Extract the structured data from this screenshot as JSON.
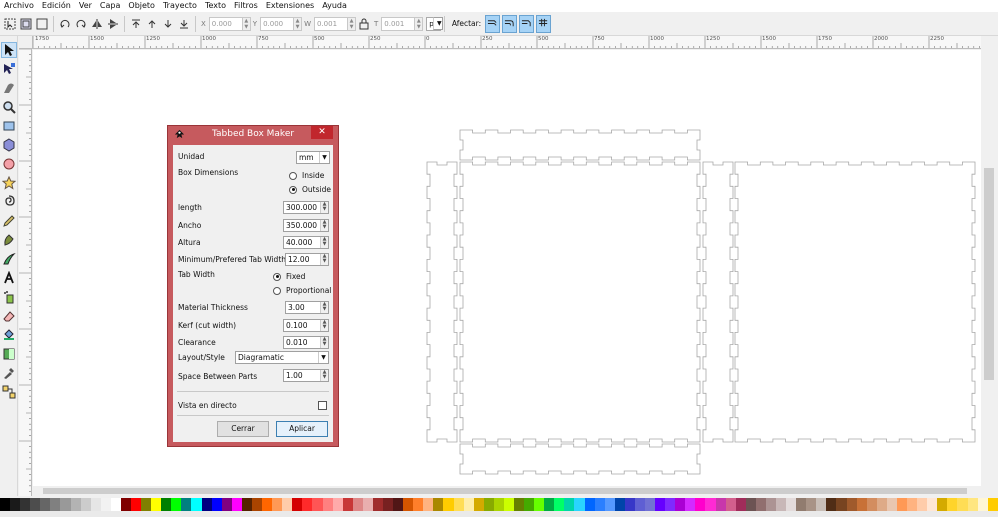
{
  "menu": [
    "Archivo",
    "Edición",
    "Ver",
    "Capa",
    "Objeto",
    "Trayecto",
    "Texto",
    "Filtros",
    "Extensiones",
    "Ayuda"
  ],
  "toolbar": {
    "x_label": "X",
    "x_value": "0.000",
    "y_label": "Y",
    "y_value": "0.000",
    "w_label": "W",
    "w_value": "0.001",
    "h_label": "T",
    "h_value": "0.001",
    "unit": "px",
    "affect_label": "Afectar:"
  },
  "ruler": {
    "h_labels": [
      "1750",
      "1500",
      "1250",
      "1000",
      "750",
      "500",
      "250",
      "0",
      "250",
      "500",
      "750",
      "1000",
      "1250",
      "1500",
      "1750",
      "2000",
      "2250"
    ]
  },
  "dialog": {
    "title": "Tabbed Box Maker",
    "close": "✕",
    "unit_label": "Unidad",
    "unit_value": "mm",
    "box_dimensions_label": "Box Dimensions",
    "inside_label": "Inside",
    "outside_label": "Outside",
    "length_label": "length",
    "length_value": "300.000",
    "width_label": "Ancho",
    "width_value": "350.000",
    "height_label": "Altura",
    "height_value": "40.000",
    "tab_min_label": "Minimum/Prefered Tab Width",
    "tab_min_value": "12.00",
    "tab_width_label": "Tab Width",
    "fixed_label": "Fixed",
    "proportional_label": "Proportional",
    "thickness_label": "Material Thickness",
    "thickness_value": "3.00",
    "kerf_label": "Kerf (cut width)",
    "kerf_value": "0.100",
    "clearance_label": "Clearance",
    "clearance_value": "0.010",
    "layout_label": "Layout/Style",
    "layout_value": "Diagramatic",
    "spacing_label": "Space Between Parts",
    "spacing_value": "1.00",
    "live_preview_label": "Vista en directo",
    "close_button": "Cerrar",
    "apply_button": "Aplicar"
  },
  "palette": [
    "#000000",
    "#1a1a1a",
    "#333333",
    "#4d4d4d",
    "#666666",
    "#808080",
    "#999999",
    "#b3b3b3",
    "#cccccc",
    "#e6e6e6",
    "#f2f2f2",
    "#ffffff",
    "#800000",
    "#ff0000",
    "#808000",
    "#ffff00",
    "#008000",
    "#00ff00",
    "#008080",
    "#00ffff",
    "#000080",
    "#0000ff",
    "#800080",
    "#ff00ff",
    "#552200",
    "#aa4400",
    "#ff6600",
    "#ff9955",
    "#ffccaa",
    "#d40000",
    "#ff2a2a",
    "#ff5555",
    "#ff8080",
    "#ffaaaa",
    "#c83737",
    "#de8787",
    "#e9afaf",
    "#a02c2c",
    "#782121",
    "#501616",
    "#d45500",
    "#ff7f2a",
    "#ffb380",
    "#aa8800",
    "#ffcc00",
    "#ffdd55",
    "#ffeeaa",
    "#d4aa00",
    "#88aa00",
    "#aad400",
    "#ccff00",
    "#668000",
    "#44aa00",
    "#66ff00",
    "#00aa44",
    "#00ff66",
    "#00d4aa",
    "#2ad4ff",
    "#0066ff",
    "#2a7fff",
    "#5599ff",
    "#0044aa",
    "#3737c8",
    "#5f5fd3",
    "#7171d3",
    "#6600ff",
    "#7f2aff",
    "#aa00d4",
    "#d42aff",
    "#ff00cc",
    "#ff2ad4",
    "#c837ab",
    "#d35f8d",
    "#a02c5a",
    "#6c5353",
    "#916f6f",
    "#ac9393",
    "#c8b7b7",
    "#e3dbdb",
    "#917c6f",
    "#a89386",
    "#c8beb7",
    "#502d16",
    "#784421",
    "#a05a2c",
    "#c87137",
    "#d38d5f",
    "#deaa87",
    "#e9c6af",
    "#ff9955",
    "#ffb380",
    "#ffccaa",
    "#ffe6d5",
    "#d4aa00",
    "#ffd42a",
    "#ffdd55",
    "#ffe680",
    "#fff6d5",
    "#ffcc00"
  ]
}
